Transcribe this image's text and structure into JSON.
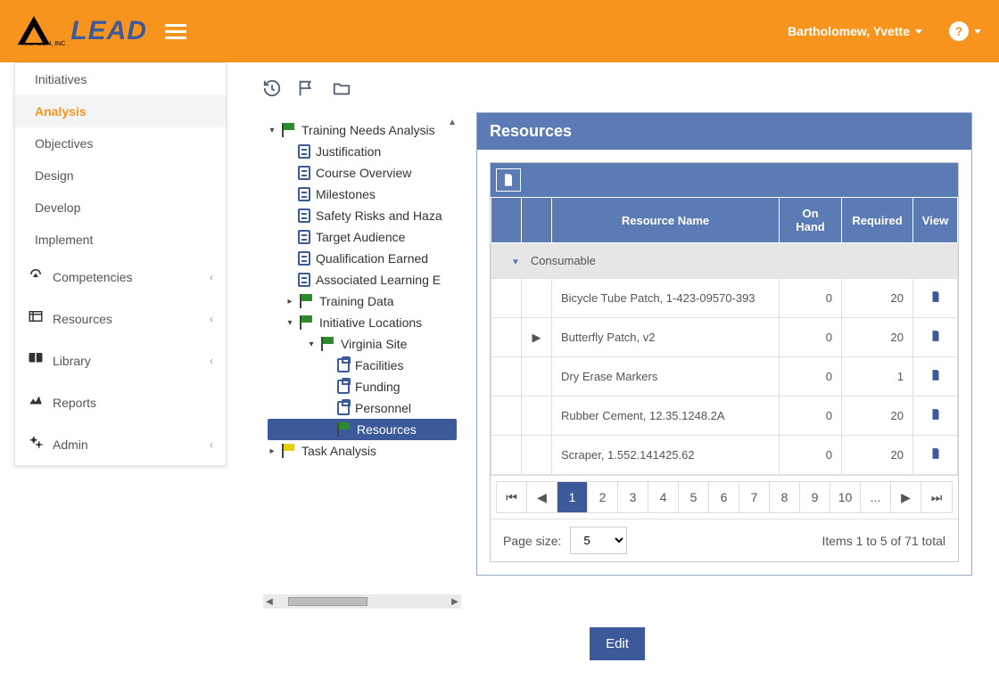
{
  "brand": {
    "text": "LEAD",
    "sub": "AIMEREON, INC"
  },
  "user": {
    "name": "Bartholomew, Yvette"
  },
  "sidebar": {
    "phases": [
      {
        "label": "Initiatives",
        "selected": false
      },
      {
        "label": "Analysis",
        "selected": true
      },
      {
        "label": "Objectives",
        "selected": false
      },
      {
        "label": "Design",
        "selected": false
      },
      {
        "label": "Develop",
        "selected": false
      },
      {
        "label": "Implement",
        "selected": false
      }
    ],
    "groups": [
      {
        "icon": "gauge",
        "label": "Competencies"
      },
      {
        "icon": "resources",
        "label": "Resources"
      },
      {
        "icon": "book",
        "label": "Library"
      },
      {
        "icon": "chart",
        "label": "Reports"
      },
      {
        "icon": "gears",
        "label": "Admin"
      }
    ]
  },
  "tree": {
    "root": {
      "label": "Training Needs Analysis",
      "icon": "flag-green",
      "children": [
        {
          "label": "Justification",
          "icon": "doc"
        },
        {
          "label": "Course Overview",
          "icon": "doc"
        },
        {
          "label": "Milestones",
          "icon": "doc"
        },
        {
          "label": "Safety Risks and Haza",
          "icon": "doc"
        },
        {
          "label": "Target Audience",
          "icon": "doc"
        },
        {
          "label": "Qualification Earned",
          "icon": "doc"
        },
        {
          "label": "Associated Learning E",
          "icon": "doc"
        },
        {
          "label": "Training Data",
          "icon": "flag-green"
        },
        {
          "label": "Initiative Locations",
          "icon": "flag-green",
          "children": [
            {
              "label": "Virginia Site",
              "icon": "flag-green",
              "children": [
                {
                  "label": "Facilities",
                  "icon": "clip"
                },
                {
                  "label": "Funding",
                  "icon": "clip"
                },
                {
                  "label": "Personnel",
                  "icon": "clip"
                },
                {
                  "label": "Resources",
                  "icon": "flag-green",
                  "selected": true
                }
              ]
            }
          ]
        }
      ]
    },
    "task": {
      "label": "Task Analysis",
      "icon": "flag-yellow"
    }
  },
  "panel": {
    "title": "Resources",
    "columns": {
      "name": "Resource Name",
      "onhand": "On Hand",
      "required": "Required",
      "view": "View"
    },
    "group": "Consumable",
    "rows": [
      {
        "name": "Bicycle Tube Patch, 1-423-09570-393",
        "onhand": 0,
        "required": 20,
        "expandable": false
      },
      {
        "name": "Butterfly Patch, v2",
        "onhand": 0,
        "required": 20,
        "expandable": true
      },
      {
        "name": "Dry Erase Markers",
        "onhand": 0,
        "required": 1,
        "expandable": false
      },
      {
        "name": "Rubber Cement, 12.35.1248.2A",
        "onhand": 0,
        "required": 20,
        "expandable": false
      },
      {
        "name": "Scraper, 1.552.141425.62",
        "onhand": 0,
        "required": 20,
        "expandable": false
      }
    ],
    "pager": {
      "pages": [
        "1",
        "2",
        "3",
        "4",
        "5",
        "6",
        "7",
        "8",
        "9",
        "10",
        "..."
      ],
      "active": "1"
    },
    "page_size": {
      "label": "Page size:",
      "value": "5"
    },
    "items_info": "Items 1 to 5 of 71 total",
    "edit": "Edit"
  }
}
